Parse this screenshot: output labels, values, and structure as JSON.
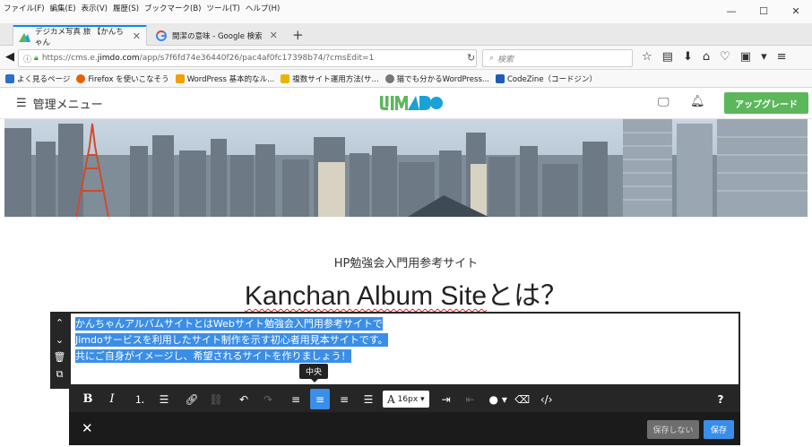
{
  "menubar": {
    "items": [
      "ファイル(F)",
      "編集(E)",
      "表示(V)",
      "履歴(S)",
      "ブックマーク(B)",
      "ツール(T)",
      "ヘルプ(H)"
    ],
    "window_controls": [
      "—",
      "☐",
      "✕"
    ]
  },
  "tabs": [
    {
      "label": "デジカメ写真 旅 【かんちゃん",
      "close": "✕",
      "active": true
    },
    {
      "label": "閲潔の意味 - Google 検索",
      "close": "✕",
      "active": false
    }
  ],
  "newtab": "+",
  "nav": {
    "url_host_prefix": "https://cms.e.",
    "url_host": "jimdo.com",
    "url_path": "/app/s7f6fd74e36440f26/pac4af0fc17398b74/?cmsEdit=1",
    "search_placeholder": "検索"
  },
  "bookmarks": [
    {
      "label": "よく見るページ",
      "color": "#2a6fc9"
    },
    {
      "label": "Firefox を使いこなそう",
      "color": "#e66000"
    },
    {
      "label": "WordPress 基本的なル...",
      "color": "#f0a000"
    },
    {
      "label": "複数サイト運用方法(サ...",
      "color": "#e8b400"
    },
    {
      "label": "猫でも分かるWordPress...",
      "color": "#777777"
    },
    {
      "label": "CodeZine（コードジン）",
      "color": "#1e5bb8"
    }
  ],
  "jimdo": {
    "menu_label": "管理メニュー",
    "upgrade_label": "アップグレード",
    "brand_colors": {
      "green": "#5cb75c",
      "accent": "#1aa2d8"
    }
  },
  "content": {
    "subtitle": "HP勉強会入門用参考サイト",
    "title_latin": "Kanchan Album Site",
    "title_jp": "とは？"
  },
  "editor": {
    "lines": [
      "かんちゃんアルバムサイトとはWebサイト勉強会入門用参考サイトで",
      "Jimdoサービスを利用したサイト制作を示す初心者用見本サイトです。",
      "共にご自身がイメージし、希望されるサイトを作りましょう！"
    ],
    "tooltip": "中央",
    "toolbar": {
      "bold": "B",
      "italic": "I",
      "font_size": "16px",
      "help": "?"
    },
    "cancel_label": "保存しない",
    "save_label": "保存",
    "close": "✕"
  }
}
